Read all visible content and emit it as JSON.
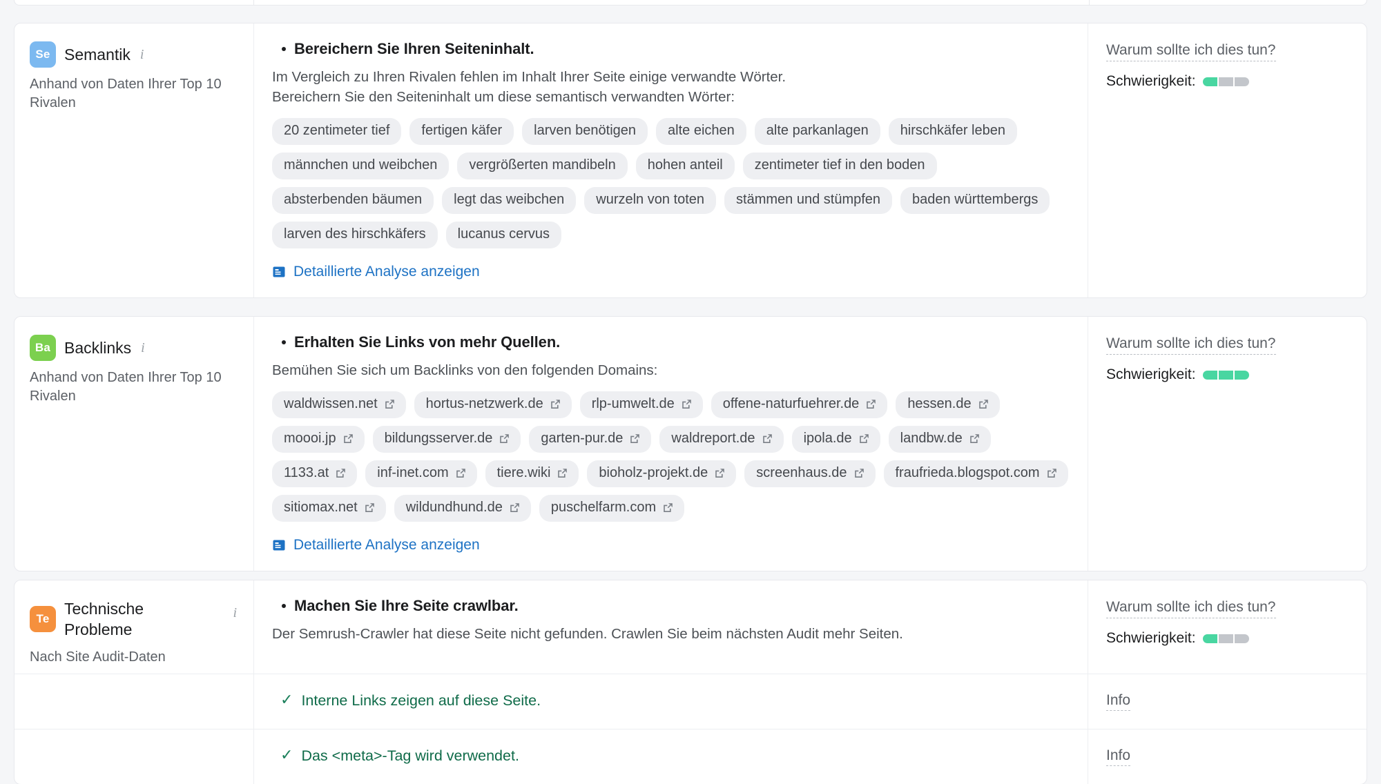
{
  "sections": [
    {
      "id": "semantik",
      "badge": {
        "text": "Se",
        "color": "#7cb9f0"
      },
      "title": "Semantik",
      "info_icon": "info-icon",
      "subtitle": "Anhand von Daten Ihrer Top 10 Rivalen",
      "headline": "Bereichern Sie Ihren Seiteninhalt.",
      "description_line1": "Im Vergleich zu Ihren Rivalen fehlen im Inhalt Ihrer Seite einige verwandte Wörter.",
      "description_line2": "Bereichern Sie den Seiteninhalt um diese semantisch verwandten Wörter:",
      "tags": [
        "20 zentimeter tief",
        "fertigen käfer",
        "larven benötigen",
        "alte eichen",
        "alte parkanlagen",
        "hirschkäfer leben",
        "männchen und weibchen",
        "vergrößerten mandibeln",
        "hohen anteil",
        "zentimeter tief in den boden",
        "absterbenden bäumen",
        "legt das weibchen",
        "wurzeln von toten",
        "stämmen und stümpfen",
        "baden württembergs",
        "larven des hirschkäfers",
        "lucanus cervus"
      ],
      "analysis_link": "Detaillierte Analyse anzeigen",
      "why_link": "Warum sollte ich dies tun?",
      "difficulty_label": "Schwierigkeit:",
      "difficulty_filled": 1,
      "difficulty_total": 3
    },
    {
      "id": "backlinks",
      "badge": {
        "text": "Ba",
        "color": "#7cd04f"
      },
      "title": "Backlinks",
      "info_icon": "info-icon",
      "subtitle": "Anhand von Daten Ihrer Top 10 Rivalen",
      "headline": "Erhalten Sie Links von mehr Quellen.",
      "description_line1": "Bemühen Sie sich um Backlinks von den folgenden Domains:",
      "tags": [
        "waldwissen.net",
        "hortus-netzwerk.de",
        "rlp-umwelt.de",
        "offene-naturfuehrer.de",
        "hessen.de",
        "moooi.jp",
        "bildungsserver.de",
        "garten-pur.de",
        "waldreport.de",
        "ipola.de",
        "landbw.de",
        "1133.at",
        "inf-inet.com",
        "tiere.wiki",
        "bioholz-projekt.de",
        "screenhaus.de",
        "fraufrieda.blogspot.com",
        "sitiomax.net",
        "wildundhund.de",
        "puschelfarm.com"
      ],
      "analysis_link": "Detaillierte Analyse anzeigen",
      "why_link": "Warum sollte ich dies tun?",
      "difficulty_label": "Schwierigkeit:",
      "difficulty_filled": 3,
      "difficulty_total": 3
    },
    {
      "id": "technische-probleme",
      "badge": {
        "text": "Te",
        "color": "#f5903d"
      },
      "title": "Technische Probleme",
      "info_icon": "info-icon",
      "subtitle": "Nach Site Audit-Daten",
      "headline": "Machen Sie Ihre Seite crawlbar.",
      "description_line1": "Der Semrush-Crawler hat diese Seite nicht gefunden. Crawlen Sie beim nächsten Audit mehr Seiten.",
      "why_link": "Warum sollte ich dies tun?",
      "difficulty_label": "Schwierigkeit:",
      "difficulty_filled": 1,
      "difficulty_total": 3,
      "checks": [
        {
          "text": "Interne Links zeigen auf diese Seite.",
          "info": "Info"
        },
        {
          "text": "Das <meta>-Tag wird verwendet.",
          "info": "Info"
        }
      ]
    }
  ]
}
